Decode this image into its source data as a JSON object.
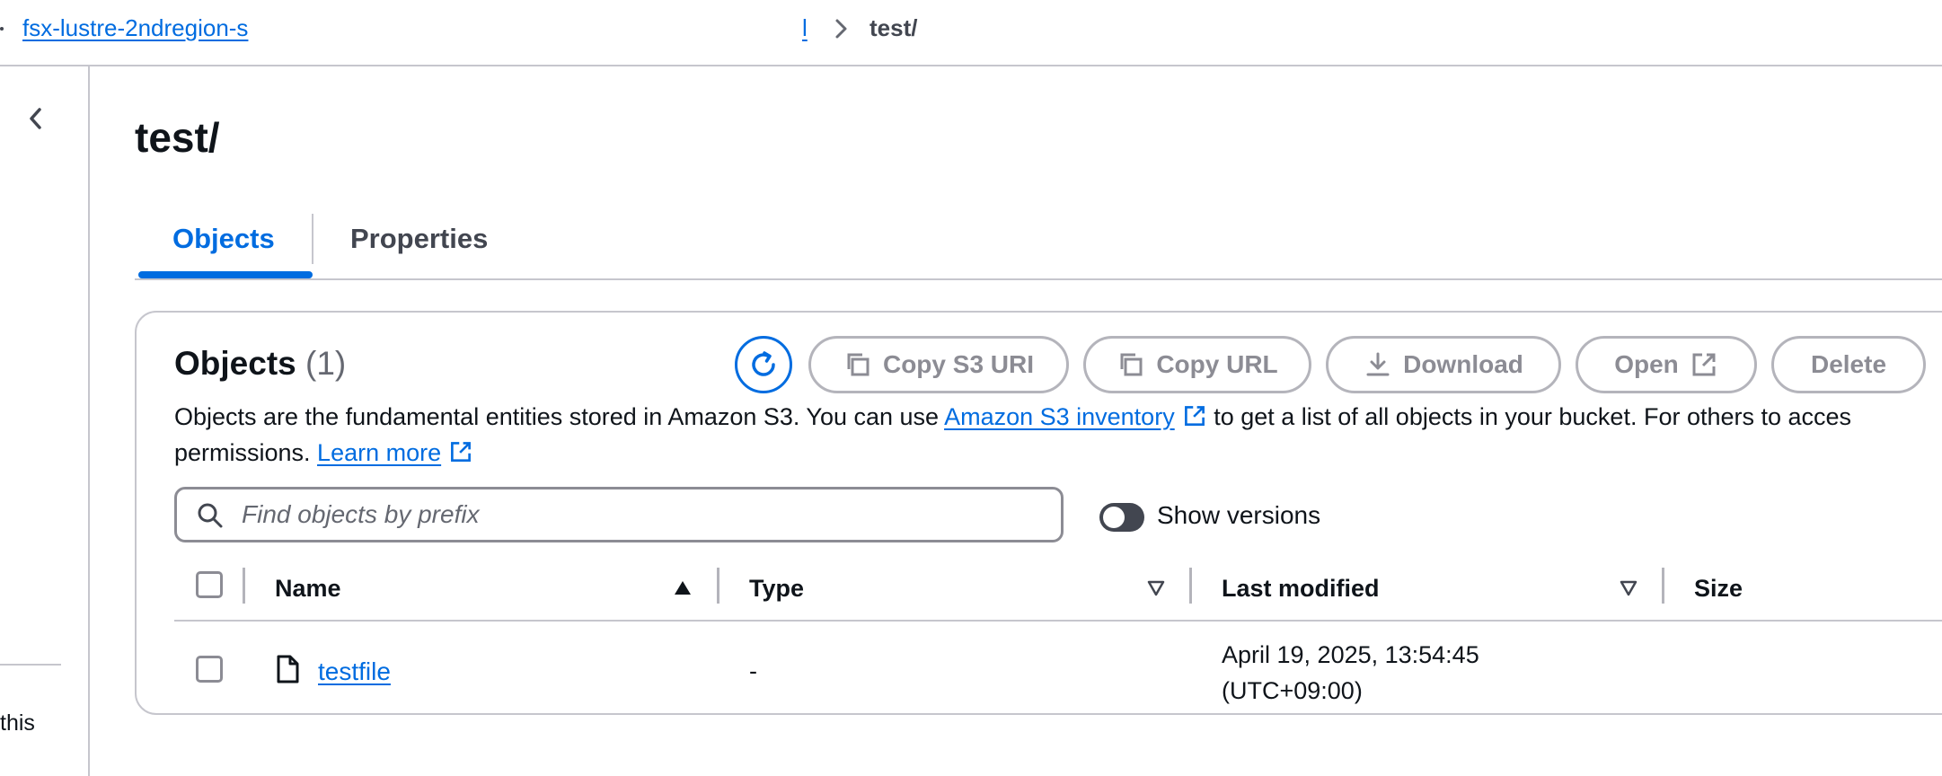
{
  "breadcrumb": {
    "bucket": "fsx-lustre-2ndregion-s",
    "fragment": "l",
    "current": "test/"
  },
  "sidebar": {
    "truncated_text": "this"
  },
  "page": {
    "title": "test/"
  },
  "tabs": [
    {
      "label": "Objects",
      "active": true
    },
    {
      "label": "Properties",
      "active": false
    }
  ],
  "objects_panel": {
    "header": "Objects",
    "count": "(1)",
    "buttons": {
      "copy_s3_uri": "Copy S3 URI",
      "copy_url": "Copy URL",
      "download": "Download",
      "open": "Open",
      "delete": "Delete"
    },
    "description": {
      "part1": "Objects are the fundamental entities stored in Amazon S3. You can use ",
      "inventory_link": "Amazon S3 inventory",
      "part2": " to get a list of all objects in your bucket. For others to acces",
      "part3": "permissions. ",
      "learn_more": "Learn more"
    },
    "search": {
      "placeholder": "Find objects by prefix",
      "value": ""
    },
    "show_versions": {
      "label": "Show versions",
      "enabled": false
    },
    "table": {
      "columns": [
        "Name",
        "Type",
        "Last modified",
        "Size"
      ],
      "rows": [
        {
          "name": "testfile",
          "type": "-",
          "last_modified_line1": "April 19, 2025, 13:54:45",
          "last_modified_line2": "(UTC+09:00)",
          "size": ""
        }
      ]
    }
  },
  "colors": {
    "accent": "#006ce0",
    "border": "#c6c6cd",
    "disabled_text": "#8c8c94",
    "text": "#0f141a"
  }
}
